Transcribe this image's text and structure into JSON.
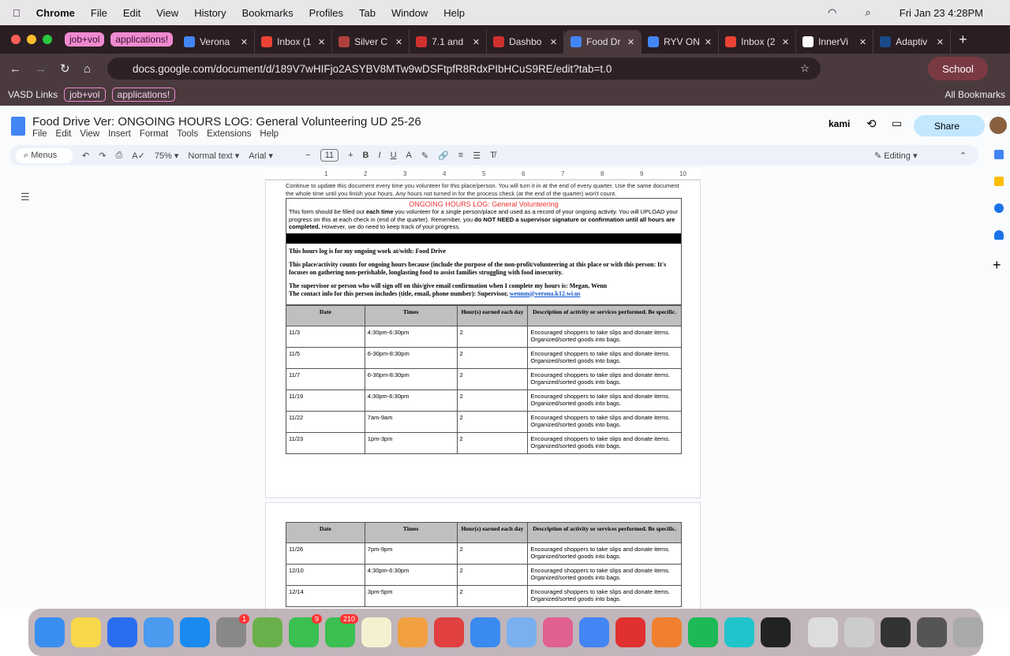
{
  "menubar": {
    "app": "Chrome",
    "items": [
      "File",
      "Edit",
      "View",
      "History",
      "Bookmarks",
      "Profiles",
      "Tab",
      "Window",
      "Help"
    ],
    "datetime": "Fri Jan 23  4:28PM"
  },
  "tab_groups": [
    "job+vol",
    "applications!"
  ],
  "tabs": [
    {
      "title": "Verona",
      "color": "#4285f4"
    },
    {
      "title": "Inbox (1",
      "color": "#ea4335"
    },
    {
      "title": "Silver C",
      "color": "#b04040"
    },
    {
      "title": "7.1 and",
      "color": "#d03030"
    },
    {
      "title": "Dashbo",
      "color": "#d03030"
    },
    {
      "title": "Food Dr",
      "color": "#4285f4",
      "active": true
    },
    {
      "title": "RYV ON",
      "color": "#4285f4"
    },
    {
      "title": "Inbox (2",
      "color": "#ea4335"
    },
    {
      "title": "InnerVi",
      "color": "#ffffff"
    },
    {
      "title": "Adaptiv",
      "color": "#1a4a8a"
    }
  ],
  "address": {
    "url": "docs.google.com/document/d/189V7wHIFjo2ASYBV8MTw9wDSFtpfR8RdxPIbHCuS9RE/edit?tab=t.0",
    "profile": "School"
  },
  "bookmarks": {
    "items": [
      "VASD Links",
      "job+vol",
      "applications!"
    ],
    "all": "All Bookmarks"
  },
  "doc": {
    "title": "Food Drive Ver: ONGOING HOURS LOG: General Volunteering UD 25-26",
    "menus": [
      "File",
      "Edit",
      "View",
      "Insert",
      "Format",
      "Tools",
      "Extensions",
      "Help"
    ],
    "kami": "kami",
    "share": "Share"
  },
  "toolbar": {
    "menus": "Menus",
    "zoom": "75%",
    "style": "Normal text",
    "font": "Arial",
    "size": "11",
    "mode": "Editing"
  },
  "ruler": [
    "1",
    "2",
    "3",
    "4",
    "5",
    "6",
    "7",
    "8",
    "9",
    "10"
  ],
  "content": {
    "intro": "Continue to update this document every time you volunteer for this place/person. You will turn it in at the end of every quarter. Use the same document the whole time until you finish your hours. Any hours not turned in for the process check (at the end of the quarter) won't count.",
    "heading": "ONGOING HOURS LOG: General Volunteering",
    "form_a": "This form should be filled out ",
    "form_b": "each time",
    "form_c": " you volunteer for a single person/place and used as a record of your ongoing activity. You will UPLOAD your progress on this at each check in (end of the quarter). Remember, you ",
    "form_d": "do NOT NEED a supervisor signature or confirmation until all hours are completed.",
    "form_e": " However, we do need to keep track of your progress.",
    "work": "This hours log is for my ongoing work at/with: Food Drive",
    "purpose": "This place/activity counts for ongoing hours because (include the purpose of the non-profit/volunteering at this place or with this person: It's focuses on gathering non-perishable, longlasting food to assist families struggling with food insecurity.",
    "supervisor": "The supervisor or person who will sign off on this/give email confirmation when I complete my hours is: Megan, Wenn",
    "contact": "The contact info for this person includes (title, email, phone number): Supervisor, ",
    "email": "wennm@verona.k12.wi.us"
  },
  "table": {
    "headers": [
      "Date",
      "Times",
      "Hour(s) earned each day",
      "Description of activity or services performed. Be specific."
    ],
    "page1": [
      [
        "11/3",
        "4:30pm-6:30pm",
        "2",
        "Encouraged shoppers to take slips and donate items. Organized/sorted goods into bags."
      ],
      [
        "11/5",
        "6-30pm-8:30pm",
        "2",
        "Encouraged shoppers to take slips and donate items. Organized/sorted goods into bags."
      ],
      [
        "11/7",
        "6-30pm-8:30pm",
        "2",
        "Encouraged shoppers to take slips and donate items. Organized/sorted goods into bags."
      ],
      [
        "11/19",
        "4:30pm-6:30pm",
        "2",
        "Encouraged shoppers to take slips and donate items. Organized/sorted goods into bags."
      ],
      [
        "11/22",
        "7am-9am",
        "2",
        "Encouraged shoppers to take slips and donate items. Organized/sorted goods into bags."
      ],
      [
        "11/23",
        "1pm-3pm",
        "2",
        "Encouraged shoppers to take slips and donate items. Organized/sorted goods into bags."
      ]
    ],
    "page2": [
      [
        "11/26",
        "7pm-9pm",
        "2",
        "Encouraged shoppers to take slips and donate items. Organized/sorted goods into bags."
      ],
      [
        "12/10",
        "4:30pm-6:30pm",
        "2",
        "Encouraged shoppers to take slips and donate items. Organized/sorted goods into bags."
      ],
      [
        "12/14",
        "3pm-5pm",
        "2",
        "Encouraged shoppers to take slips and donate items. Organized/sorted goods into bags."
      ]
    ]
  },
  "dock": {
    "apps": [
      "finder",
      "notes",
      "roblox",
      "mail",
      "app-store",
      "settings",
      "maps",
      "facetime",
      "messages",
      "notes2",
      "photos",
      "canvas",
      "safari",
      "passwords",
      "launchpad",
      "chrome",
      "youtube",
      "books",
      "spotify",
      "canva",
      "quicktime",
      "preview",
      "downloads",
      "window1",
      "window2",
      "trash"
    ],
    "badges": {
      "settings": "1",
      "facetime": "9",
      "messages": "210"
    }
  }
}
